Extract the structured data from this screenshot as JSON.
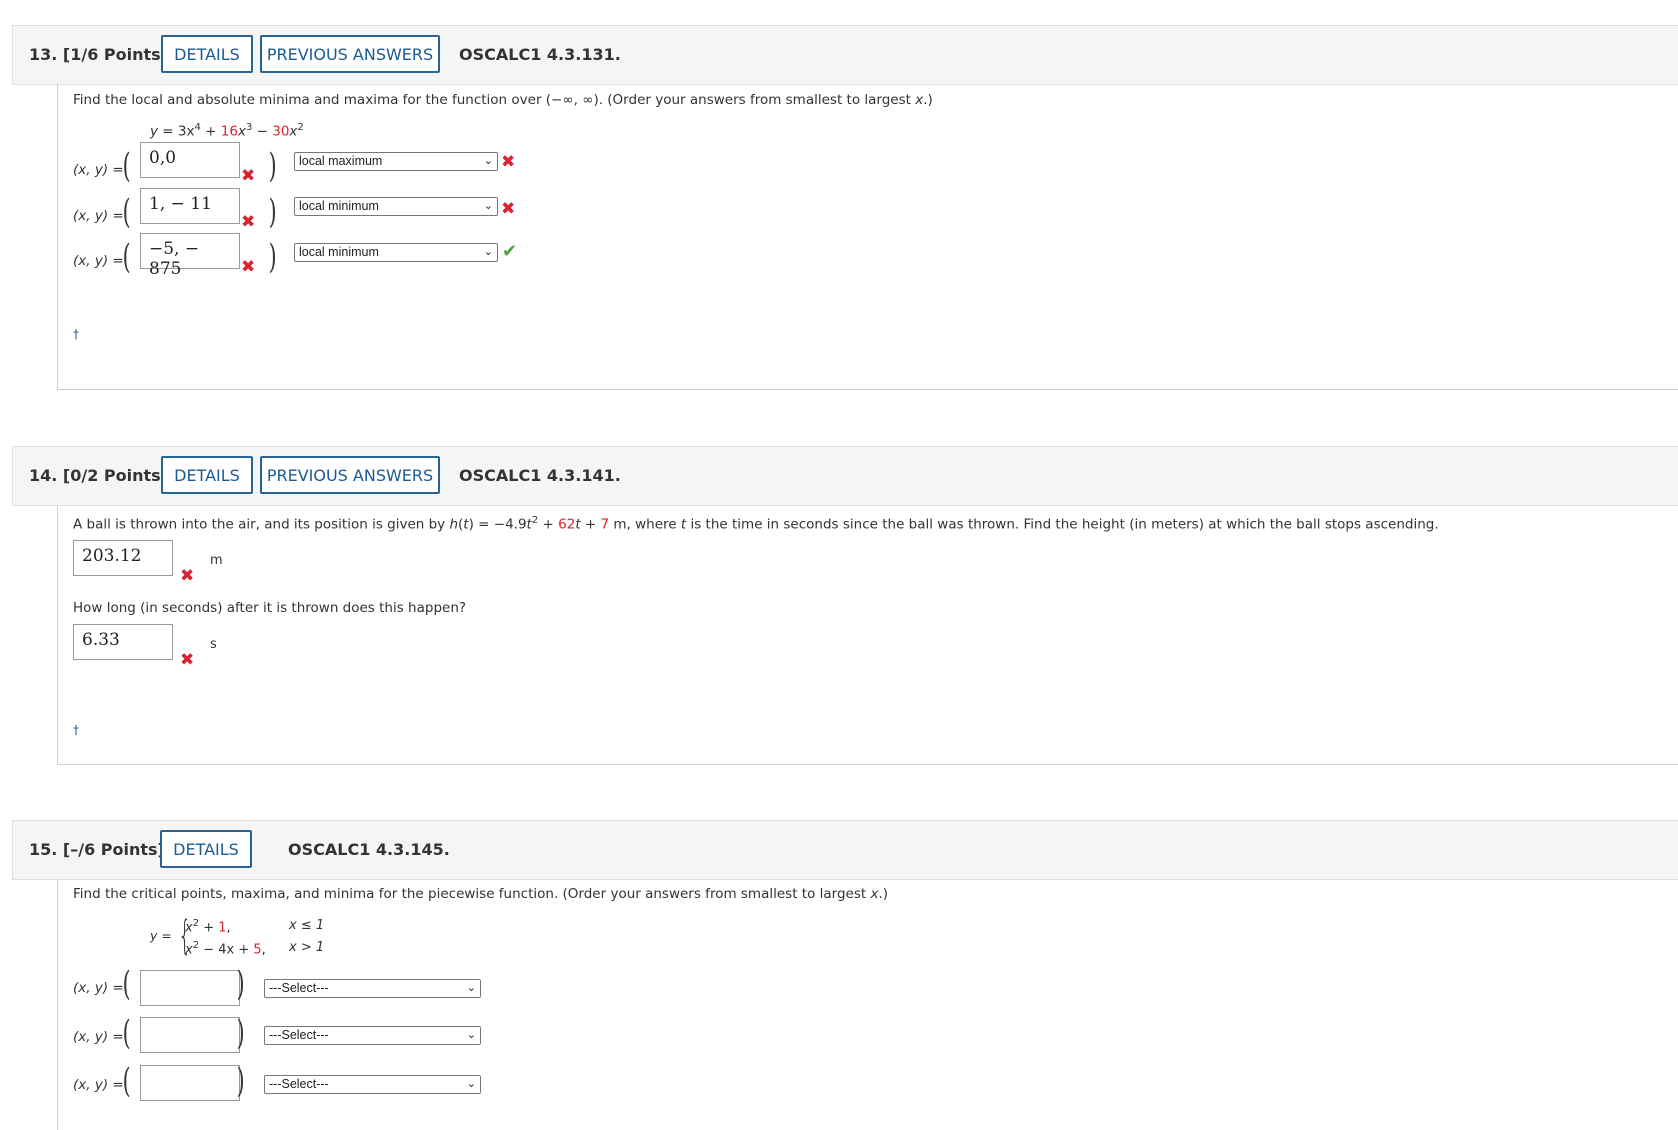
{
  "q13": {
    "number": "13.",
    "points": "[1/6 Points]",
    "details": "DETAILS",
    "previous": "PREVIOUS ANSWERS",
    "code": "OSCALC1 4.3.131.",
    "prompt_a": "Find the local and absolute minima and maxima for the function over (−∞, ∞). (Order your answers from smallest to largest ",
    "prompt_x": "x",
    "prompt_b": ".)",
    "eq_y": "y",
    "eq_a": " = 3x",
    "eq_p4": "4",
    "eq_plus": " + ",
    "eq_16": "16",
    "eq_x3": "x",
    "eq_p3": "3",
    "eq_minus": " − ",
    "eq_30": "30",
    "eq_x2": "x",
    "eq_p2": "2",
    "xy_label": "(x, y)  =",
    "rows": [
      {
        "value": "0,0",
        "select": "local maximum",
        "status": "wrong"
      },
      {
        "value": "1, − 11",
        "select": "local minimum",
        "status": "wrong"
      },
      {
        "value": "−5, − 875",
        "select": "local minimum",
        "status": "correct"
      }
    ],
    "dagger": "†"
  },
  "q14": {
    "number": "14.",
    "points": "[0/2 Points]",
    "details": "DETAILS",
    "previous": "PREVIOUS ANSWERS",
    "code": "OSCALC1 4.3.141.",
    "prompt_a": "A ball is thrown into the air, and its position is given by ",
    "prompt_h": "h",
    "prompt_b": "(",
    "prompt_t": "t",
    "prompt_c": ") = −4.9",
    "prompt_t2": "t",
    "prompt_sq": "2",
    "prompt_d": " + ",
    "prompt_62": "62",
    "prompt_t3": "t",
    "prompt_e": " + ",
    "prompt_7": "7",
    "prompt_f": " m, where ",
    "prompt_t4": "t",
    "prompt_g": " is the time in seconds since the ball was thrown. Find the height (in meters) at which the ball stops ascending.",
    "answer1": "203.12",
    "unit1": "m",
    "prompt2": "How long (in seconds) after it is thrown does this happen?",
    "answer2": "6.33",
    "unit2": "s",
    "dagger": "†"
  },
  "q15": {
    "number": "15.",
    "points": "[–/6 Points]",
    "details": "DETAILS",
    "code": "OSCALC1 4.3.145.",
    "prompt_a": "Find the critical points, maxima, and minima for the piecewise function. (Order your answers from smallest to largest ",
    "prompt_x": "x",
    "prompt_b": ".)",
    "eq_y": "y =",
    "case1_a": "x",
    "case1_sq": "2",
    "case1_b": " + ",
    "case1_1": "1",
    "case1_c": ",",
    "case1_cond": "x ≤ 1",
    "case2_a": "x",
    "case2_sq": "2",
    "case2_b": " − 4x + ",
    "case2_5": "5",
    "case2_c": ",",
    "case2_cond": "x > 1",
    "xy_label": "(x, y)  =",
    "select_placeholder": "---Select---"
  }
}
